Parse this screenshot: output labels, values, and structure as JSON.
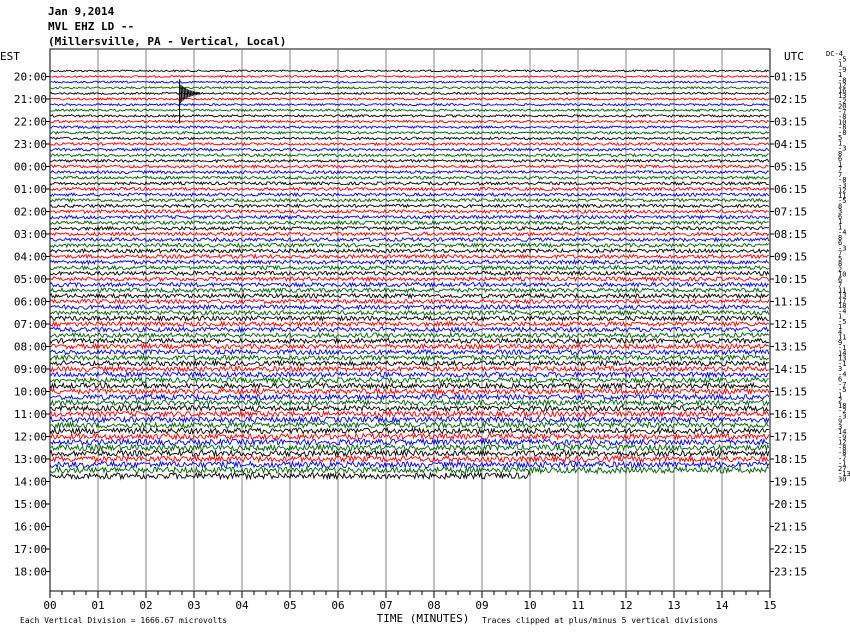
{
  "header": {
    "date": "Jan 9,2014",
    "station": "MVL EHZ LD --",
    "location": "(Millersville, PA - Vertical, Local)"
  },
  "footer": {
    "scale_note": "Each Vertical Division = 1666.67 microvolts",
    "clip_note": "Traces clipped at plus/minus 5 vertical divisions"
  },
  "chart_data": {
    "type": "line",
    "title": "",
    "xlabel": "TIME (MINUTES)",
    "left_axis_label": "EST",
    "right_axis_label": "UTC",
    "x_ticks": [
      "00",
      "01",
      "02",
      "03",
      "04",
      "05",
      "06",
      "07",
      "08",
      "09",
      "10",
      "11",
      "12",
      "13",
      "14",
      "15"
    ],
    "xlim": [
      0,
      15
    ],
    "est_labels": [
      "20:00",
      "21:00",
      "22:00",
      "23:00",
      "00:00",
      "01:00",
      "02:00",
      "03:00",
      "04:00",
      "05:00",
      "06:00",
      "07:00",
      "08:00",
      "09:00",
      "10:00",
      "11:00",
      "12:00",
      "13:00",
      "14:00",
      "15:00",
      "16:00",
      "17:00",
      "18:00"
    ],
    "utc_labels": [
      "01:15",
      "02:15",
      "03:15",
      "04:15",
      "05:15",
      "06:15",
      "07:15",
      "08:15",
      "09:15",
      "10:15",
      "11:15",
      "12:15",
      "13:15",
      "14:15",
      "15:15",
      "16:15",
      "17:15",
      "18:15",
      "19:15",
      "20:15",
      "21:15",
      "22:15",
      "23:15"
    ],
    "lines_per_hour": 4,
    "trace_colors": [
      "#000000",
      "#ff0000",
      "#0000ff",
      "#006400"
    ],
    "first_line_hour_offset": -0.25,
    "last_trace_end_minute": 10,
    "full_traces": 72,
    "grid": true,
    "legend": "none",
    "events": [
      {
        "label": "earthquake",
        "hour_row": 1,
        "minute": 2.7
      }
    ],
    "right_dc_labels": [
      "DC-4",
      "-5",
      "1",
      "-9",
      "1",
      "-8",
      "12",
      "16",
      "13",
      "-2",
      "20",
      "-7",
      "-8",
      "10",
      "-8",
      "-8",
      "5",
      "1",
      "-3",
      "8",
      "6",
      "1",
      "7",
      "7",
      "-8",
      "-3",
      "12",
      "11",
      "-5",
      "8",
      "3",
      "6",
      "1",
      "1",
      "-4",
      "8",
      "6",
      "-3",
      "7",
      "5",
      "8",
      "2",
      "10",
      "6",
      "7",
      "11",
      "13",
      "17",
      "18",
      "-4",
      "1",
      "-5",
      "1",
      "4",
      "11",
      "9",
      "-1",
      "14",
      "13",
      "-1",
      "3",
      "-4",
      "6",
      "-7",
      "-5",
      "1",
      "2",
      "18",
      "-2",
      "-3",
      "9",
      "3",
      "14",
      "-9",
      "12",
      "-8",
      "-8",
      "-7",
      "-1",
      "27",
      "-13",
      "30"
    ]
  }
}
